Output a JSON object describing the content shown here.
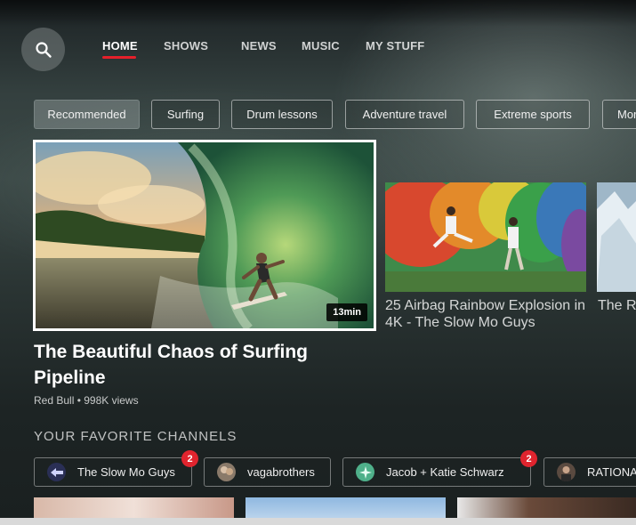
{
  "nav": {
    "items": [
      {
        "label": "HOME",
        "active": true
      },
      {
        "label": "SHOWS",
        "active": false
      },
      {
        "label": "NEWS",
        "active": false
      },
      {
        "label": "MUSIC",
        "active": false
      },
      {
        "label": "MY STUFF",
        "active": false
      }
    ]
  },
  "chips": [
    {
      "label": "Recommended",
      "active": true
    },
    {
      "label": "Surfing"
    },
    {
      "label": "Drum lessons"
    },
    {
      "label": "Adventure travel"
    },
    {
      "label": "Extreme sports"
    },
    {
      "label": "Mor"
    }
  ],
  "featured": {
    "duration": "13min",
    "title": "The Beautiful Chaos of Surfing Pipeline",
    "meta": "Red Bull • 998K views"
  },
  "videos": [
    {
      "title": "25 Airbag Rainbow Explosion in 4K - The Slow Mo Guys"
    },
    {
      "title": "The Ra Nation"
    }
  ],
  "channels": {
    "section_title": "YOUR FAVORITE CHANNELS",
    "items": [
      {
        "name": "The Slow Mo Guys",
        "badge": "2"
      },
      {
        "name": "vagabrothers",
        "badge": ""
      },
      {
        "name": "Jacob + Katie Schwarz",
        "badge": "2"
      },
      {
        "name": "RATIONAL",
        "badge": ""
      }
    ]
  },
  "colors": {
    "accent": "#e5202a",
    "badge": "#e0242e"
  },
  "icons": {
    "search": "search-icon"
  }
}
